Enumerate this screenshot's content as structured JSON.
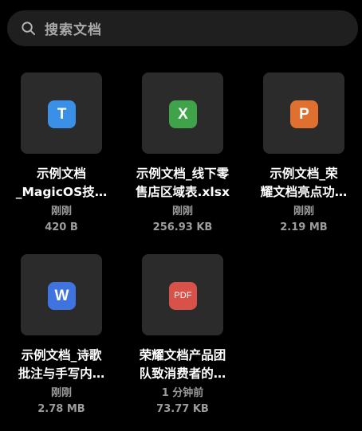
{
  "search": {
    "placeholder": "搜索文档",
    "icon": "search-icon"
  },
  "files": [
    {
      "name": "示例文档\n_MagicOS技…",
      "badge_text": "T",
      "badge_color": "#3a8fe6",
      "time": "刚刚",
      "size": "420 B"
    },
    {
      "name": "示例文档_线下零\n售店区域表.xlsx",
      "badge_text": "X",
      "badge_color": "#3fa34a",
      "time": "刚刚",
      "size": "256.93 KB"
    },
    {
      "name": "示例文档_荣\n耀文档亮点功…",
      "badge_text": "P",
      "badge_color": "#e07030",
      "time": "刚刚",
      "size": "2.19 MB"
    },
    {
      "name": "示例文档_诗歌\n批注与手写内…",
      "badge_text": "W",
      "badge_color": "#3f74e0",
      "time": "刚刚",
      "size": "2.78 MB"
    },
    {
      "name": "荣耀文档产品团\n队致消费者的…",
      "badge_text": "PDF",
      "badge_color": "#d9524a",
      "time": "1 分钟前",
      "size": "73.77 KB"
    }
  ]
}
